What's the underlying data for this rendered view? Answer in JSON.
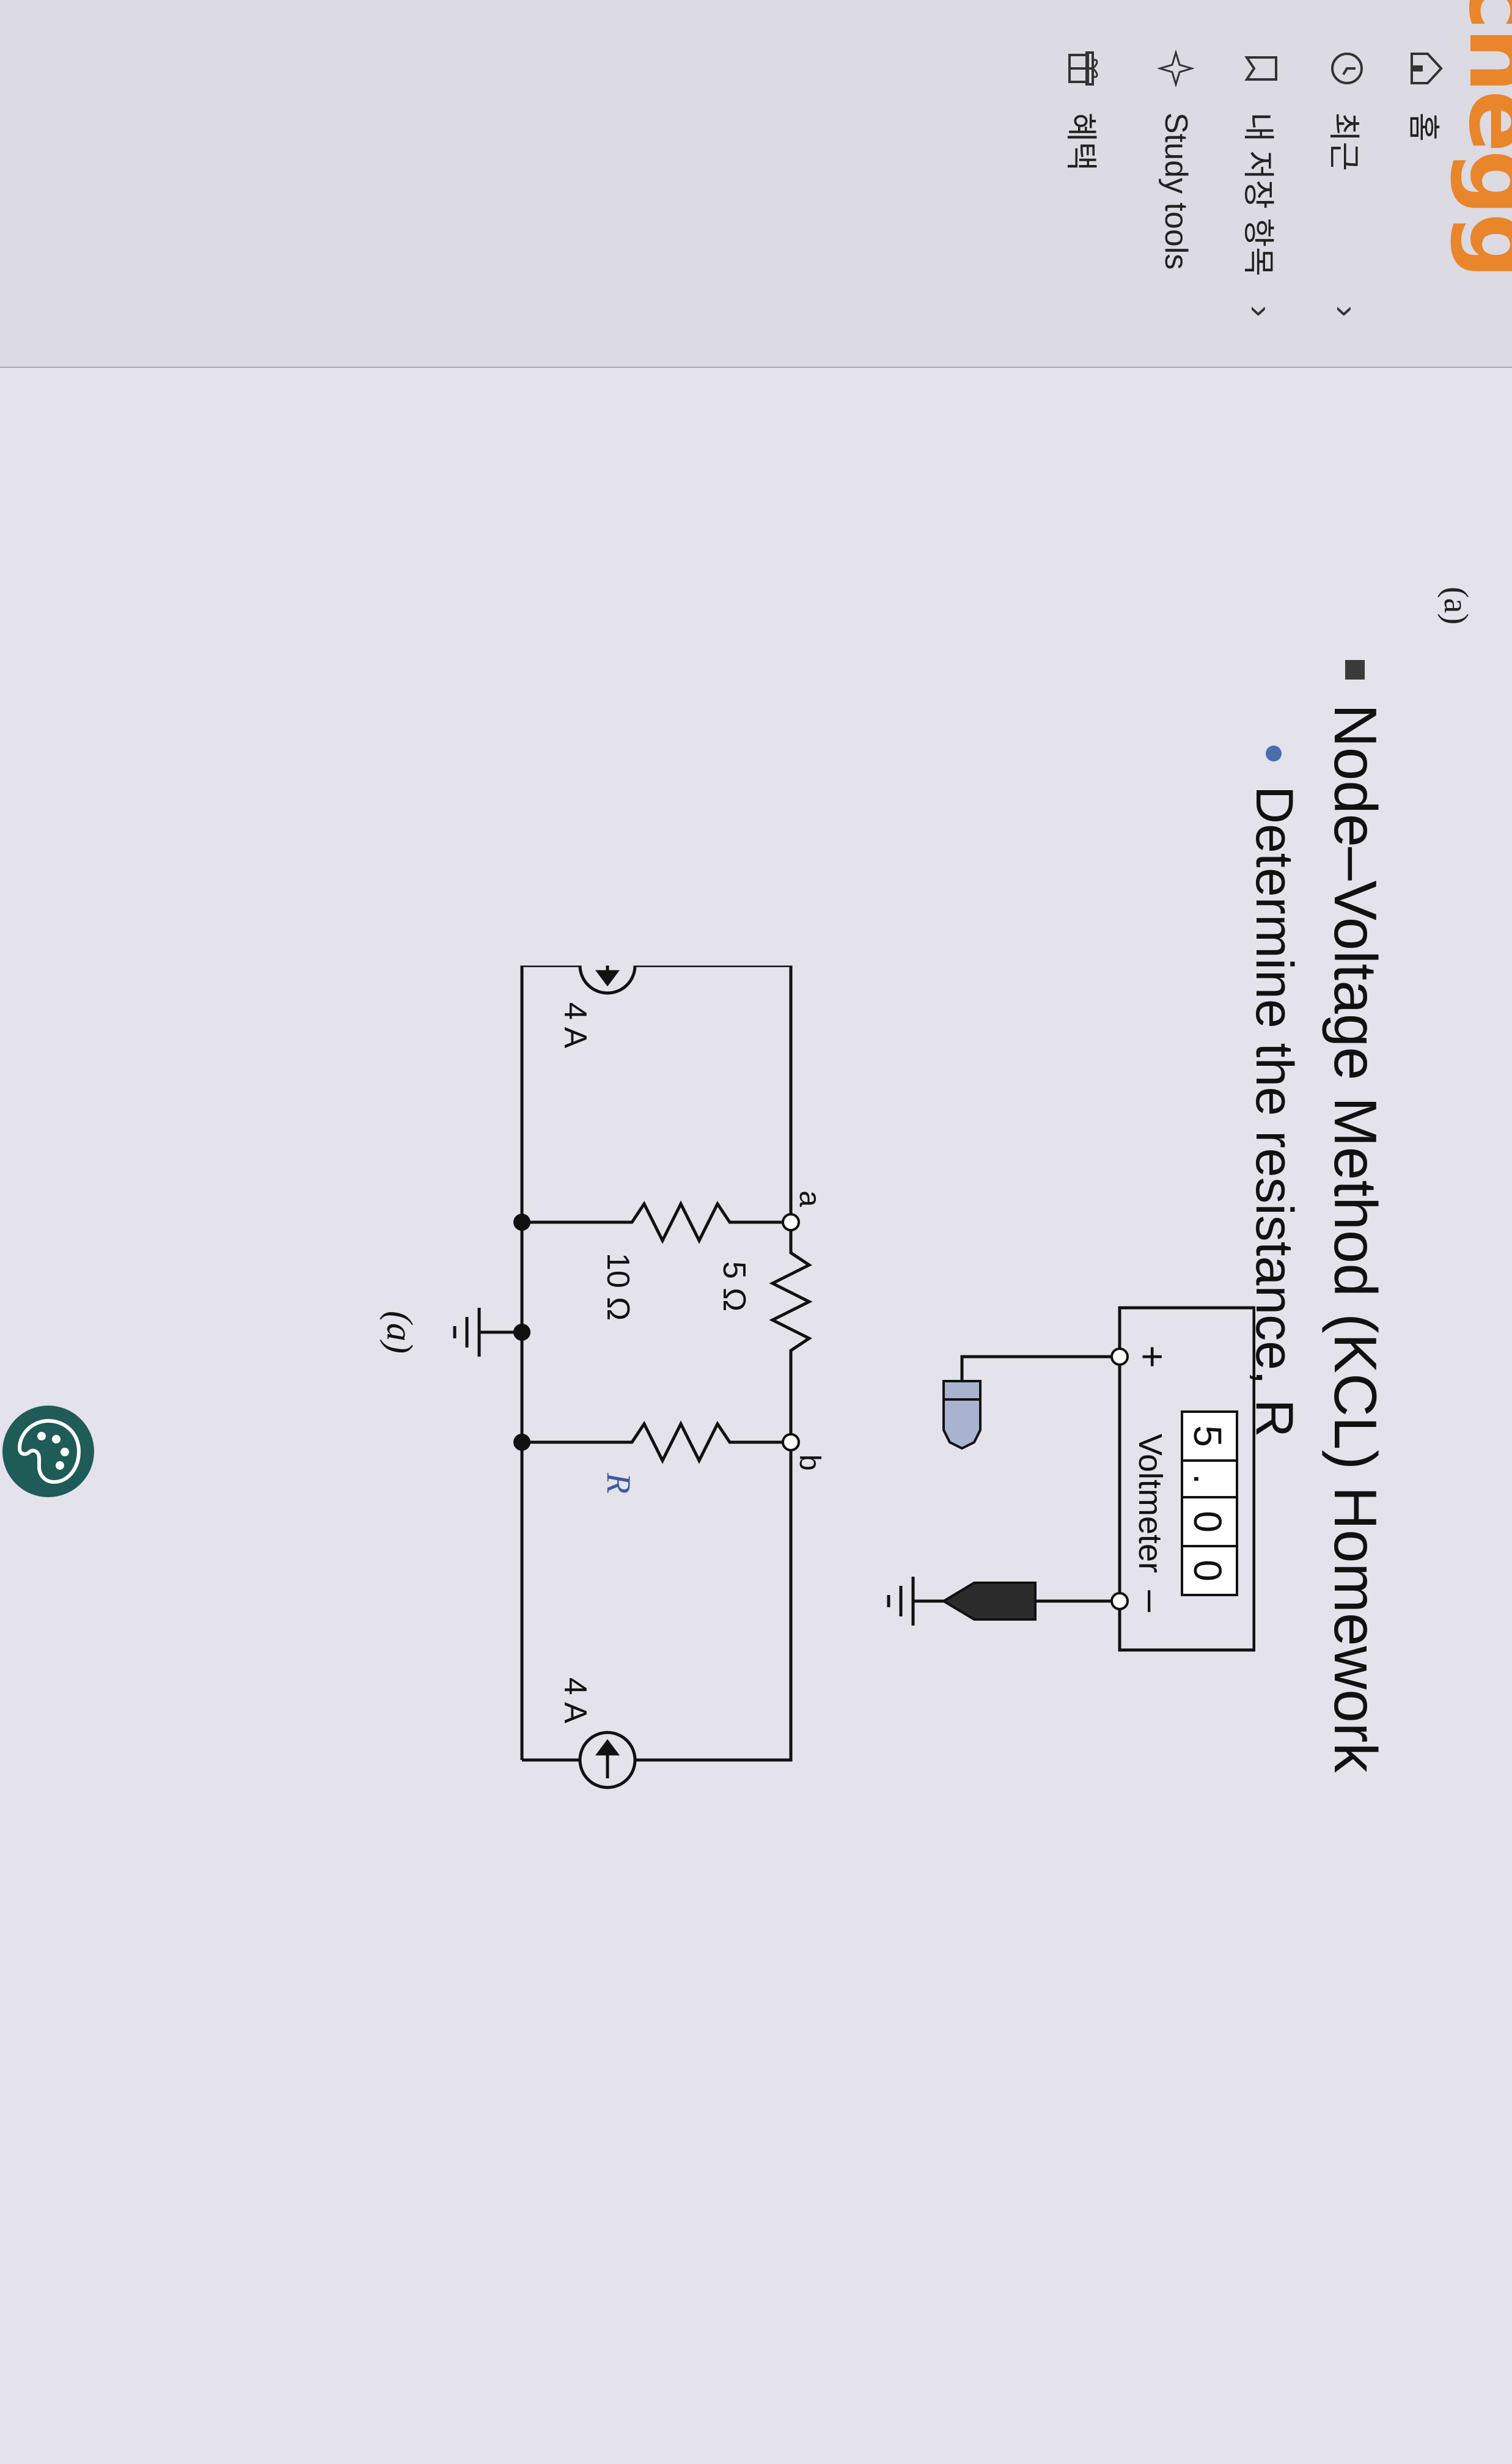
{
  "app": {
    "logo": "chegg"
  },
  "sidebar": {
    "items": [
      {
        "label": "홈",
        "icon": "home-icon"
      },
      {
        "label": "최근",
        "icon": "clock-icon"
      },
      {
        "label": "내 저장 항목",
        "icon": "bookmark-icon"
      },
      {
        "label": "Study tools",
        "icon": "sparkle-icon"
      },
      {
        "label": "혜택",
        "icon": "gift-icon"
      }
    ]
  },
  "slide": {
    "caption_top": "(a)",
    "heading": "Node–Voltage Method (KCL) Homework",
    "bullet": "Determine the resistance, R"
  },
  "circuit": {
    "display_digits": [
      "5",
      ".",
      "0",
      "0"
    ],
    "voltmeter_label": "Voltmeter",
    "plus": "+",
    "minus": "–",
    "node_a": "a",
    "node_b": "b",
    "r_top": "5 Ω",
    "r_left": "10 Ω",
    "r_unknown": "R",
    "source_left": "4 A",
    "source_right": "4 A",
    "caption": "(a)"
  },
  "colors": {
    "logo": "#e9852a",
    "bullet": "#4a6fae",
    "probe_positive": "#a9b3cf",
    "probe_negative": "#2b2b2b"
  }
}
